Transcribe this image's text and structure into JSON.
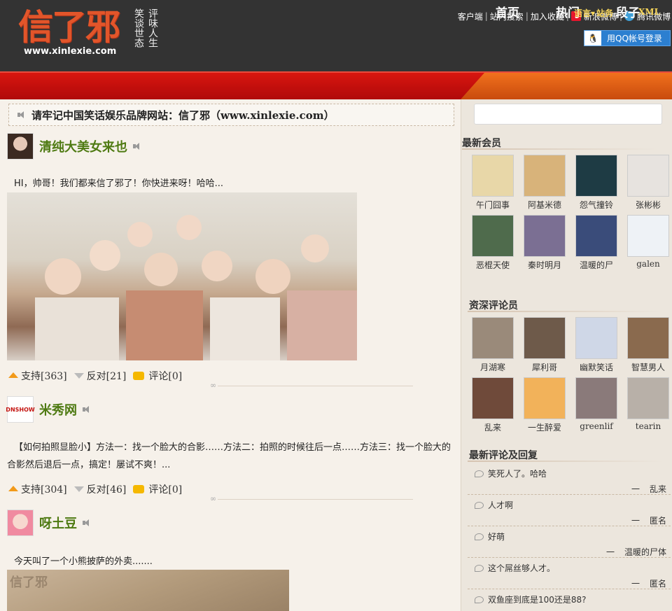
{
  "header": {
    "logo_text": "信了邪",
    "logo_url": "www.xinlexie.com",
    "slogan_col1": "笑谈世态",
    "slogan_col2": "评味人生",
    "toplinks": [
      "客户端",
      "站内搜索",
      "加入收藏",
      "新浪微博",
      "腾讯微博"
    ],
    "qq_login": "用QQ帐号登录",
    "qq_icon": "penguin-icon"
  },
  "nav": {
    "home": "首页",
    "hot": "热门",
    "duanzi": "段子",
    "lang": "语言▾",
    "site": "站务",
    "xml": "XML",
    "left_color": "#c8100d",
    "right_color": "#e0601a"
  },
  "notice": {
    "text": "请牢记中国笑话娱乐品牌网站：信了邪（www.xinlexie.com）"
  },
  "posts": [
    {
      "title": "清纯大美女来也",
      "text": "HI，帅哥！我们都来信了邪了！你快进来呀！哈哈...",
      "support": "支持[363]",
      "oppose": "反对[21]",
      "comment": "评论[0]"
    },
    {
      "title": "米秀网",
      "avatar_text": "DNSHOW",
      "text": "【如何拍照显脸小】方法一：找一个脸大的合影……方法二：拍照的时候往后一点……方法三：找一个脸大的合影然后退后一点，搞定！屡试不爽！...",
      "support": "支持[304]",
      "oppose": "反对[46]",
      "comment": "评论[0]"
    },
    {
      "title": "呀土豆",
      "text": "今天叫了一个小熊披萨的外卖.......",
      "image_watermark": "信了邪"
    }
  ],
  "sidebar": {
    "newest_members_title": "最新会员",
    "newest_members": [
      {
        "name": "午门囧事",
        "color": "#e8d7a8"
      },
      {
        "name": "阿基米德",
        "color": "#d8b37a"
      },
      {
        "name": "怨气撞铃",
        "color": "#1e3b44"
      },
      {
        "name": "张彬彬",
        "color": "#e7e3df"
      },
      {
        "name": "恶棍天使",
        "color": "#4f6b4c"
      },
      {
        "name": "秦时明月",
        "color": "#7b6f93"
      },
      {
        "name": "温暖的尸",
        "color": "#3a4c7a"
      },
      {
        "name": "galen",
        "color": "#eef2f6"
      }
    ],
    "senior_title": "资深评论员",
    "senior_members": [
      {
        "name": "月湖寒",
        "color": "#9a8a7a"
      },
      {
        "name": "犀利哥",
        "color": "#6e5a4a"
      },
      {
        "name": "幽默笑话",
        "color": "#cfd7e7"
      },
      {
        "name": "智慧男人",
        "color": "#8a6a4e"
      },
      {
        "name": "乱来",
        "color": "#6f4a3a"
      },
      {
        "name": "一生醉爱",
        "color": "#f2b25a"
      },
      {
        "name": "greenlif",
        "color": "#8a7a7a"
      },
      {
        "name": "tearin",
        "color": "#b8b0a8"
      }
    ],
    "recent_comments_title": "最新评论及回复",
    "recent_comments": [
      {
        "text": "笑死人了。哈哈",
        "author": "乱来"
      },
      {
        "text": "人才啊",
        "author": "匿名"
      },
      {
        "text": "好萌",
        "author": "温暖的尸体"
      },
      {
        "text": "这个屌丝够人才。",
        "author": "匿名"
      },
      {
        "text": "双鱼座到底是100还是88?",
        "author": ""
      }
    ]
  }
}
